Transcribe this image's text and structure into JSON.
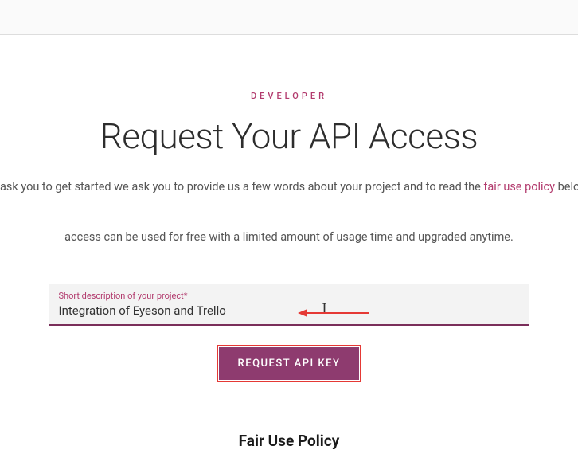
{
  "eyebrow": "DEVELOPER",
  "heading": "Request Your API Access",
  "subtext_pre": "ask you to get started we ask you to provide us a few words about your project and to read the ",
  "policy_link_text": "fair use policy",
  "subtext_post": " below",
  "subtext2": "access can be used for free with a limited amount of usage time and upgraded anytime.",
  "input": {
    "label": "Short description of your project*",
    "value": "Integration of Eyeson and Trello"
  },
  "button_label": "REQUEST API KEY",
  "fair_use_heading": "Fair Use Policy"
}
